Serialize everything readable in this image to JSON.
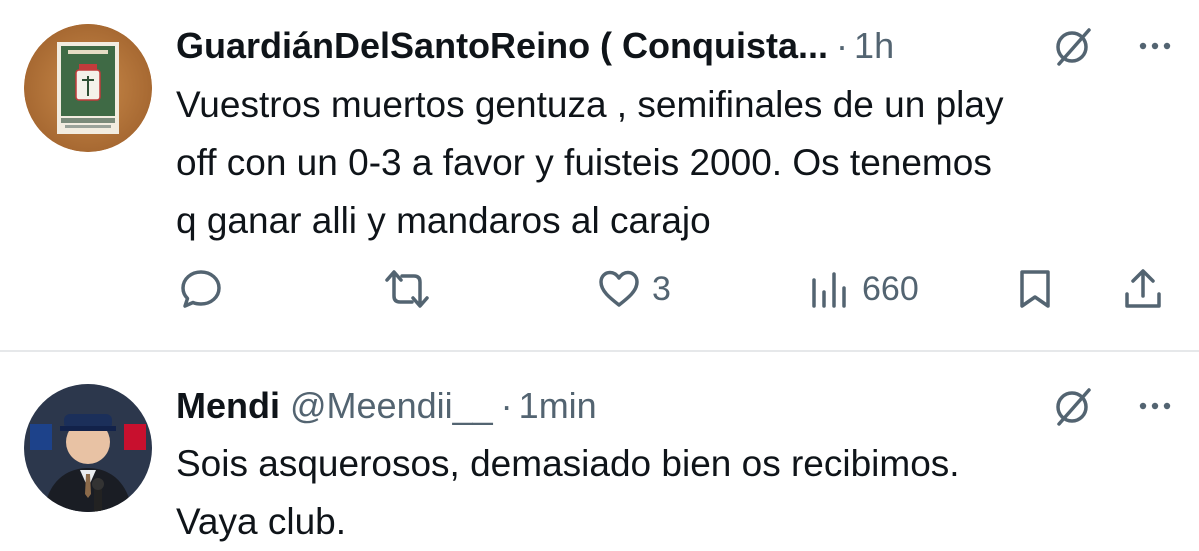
{
  "tweets": [
    {
      "display_name": "GuardiánDelSantoReino ( Conquista...",
      "handle": "",
      "separator": "·",
      "time": "1h",
      "text": "Vuestros muertos gentuza , semifinales de un play\noff con un 0-3 a favor y fuisteis 2000. Os tenemos\nq ganar alli y mandaros al carajo",
      "avatar_icon": "real-jaen-crest-avatar",
      "actions": {
        "reply_count": "",
        "retweet_count": "",
        "like_count": "3",
        "views_count": "660"
      }
    },
    {
      "display_name": "Mendi",
      "handle": "@Meendii__",
      "separator": "·",
      "time": "1min",
      "text": "Sois asquerosos, demasiado bien os recibimos.\nVaya club.",
      "avatar_icon": "nba-player-photo-avatar"
    }
  ],
  "colors": {
    "text": "#0f1419",
    "secondary": "#536471",
    "divider": "#e6e8ea"
  }
}
